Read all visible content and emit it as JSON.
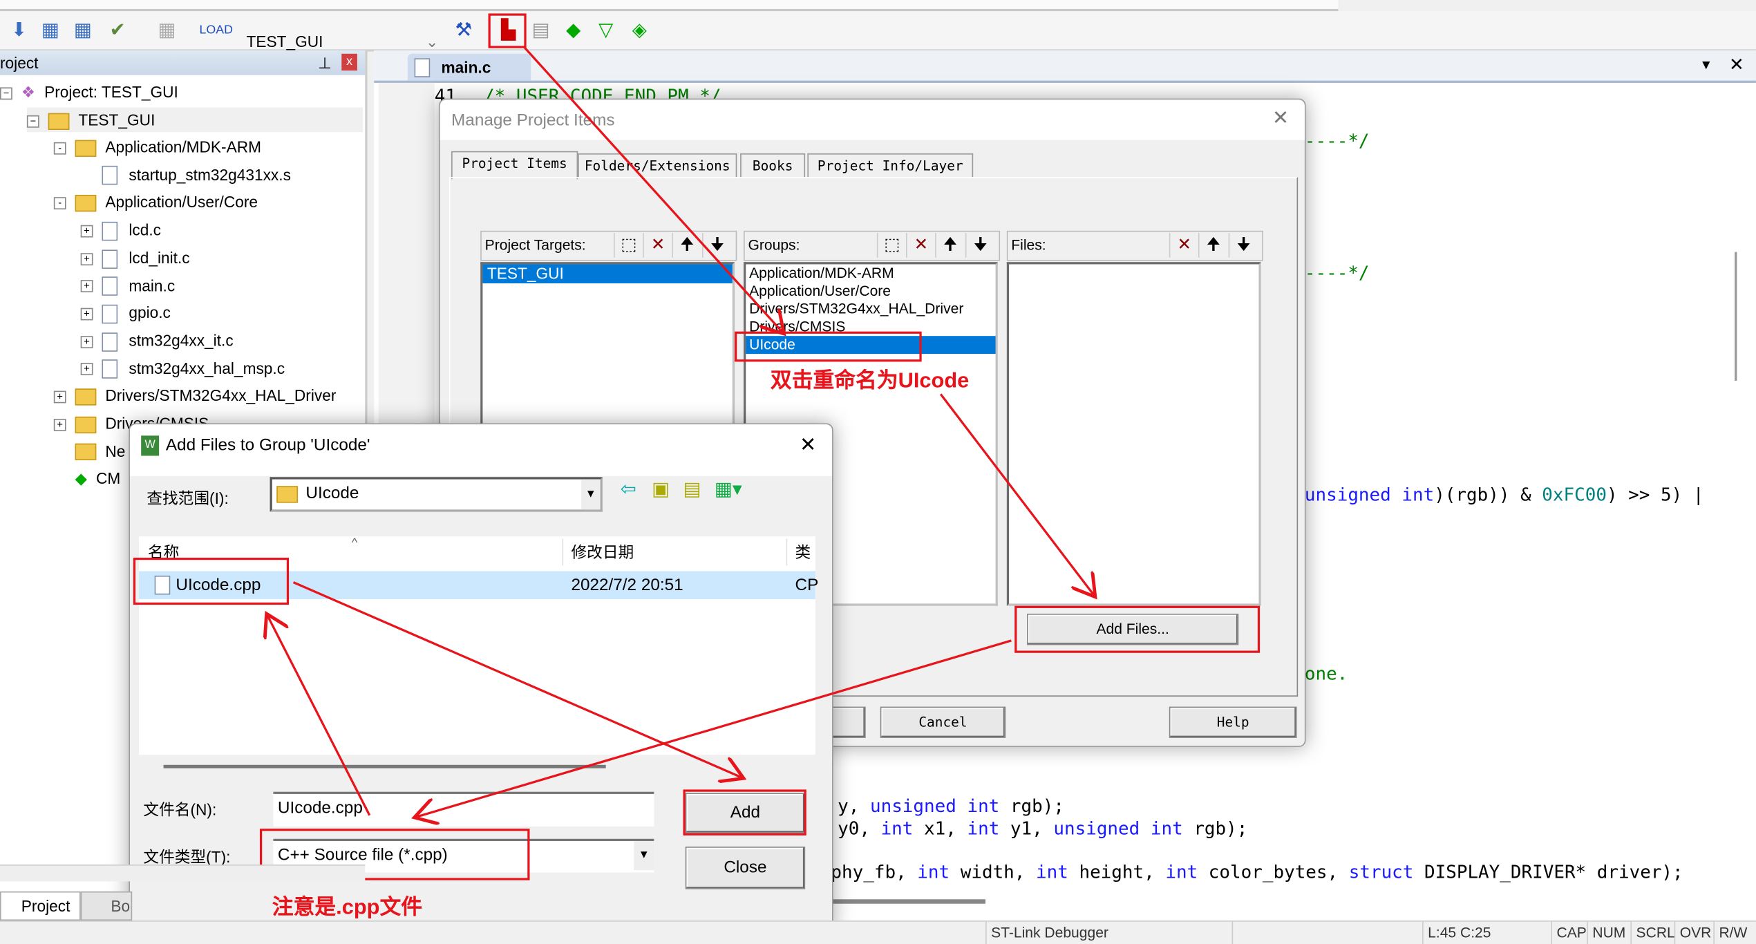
{
  "toolbar": {
    "target": "TEST_GUI",
    "icons": [
      "translate-icon",
      "build-icon",
      "rebuild-icon",
      "batch-build-icon",
      "stop-build-icon",
      "load-icon",
      "target-options-icon",
      "manage-project-items-icon",
      "select-packs-icon",
      "pack-installer-icon",
      "manage-run-time-icon",
      "software-components-icon"
    ]
  },
  "project_panel": {
    "title": "roject",
    "root": "Project: TEST_GUI",
    "target": "TEST_GUI",
    "items": [
      {
        "label": "Application/MDK-ARM",
        "type": "folder",
        "level": 2,
        "expander": "-"
      },
      {
        "label": "startup_stm32g431xx.s",
        "type": "file",
        "level": 3,
        "expander": ""
      },
      {
        "label": "Application/User/Core",
        "type": "folder",
        "level": 2,
        "expander": "-"
      },
      {
        "label": "lcd.c",
        "type": "file",
        "level": 3,
        "expander": "+"
      },
      {
        "label": "lcd_init.c",
        "type": "file",
        "level": 3,
        "expander": "+"
      },
      {
        "label": "main.c",
        "type": "file",
        "level": 3,
        "expander": "+"
      },
      {
        "label": "gpio.c",
        "type": "file",
        "level": 3,
        "expander": "+"
      },
      {
        "label": "stm32g4xx_it.c",
        "type": "file",
        "level": 3,
        "expander": "+"
      },
      {
        "label": "stm32g4xx_hal_msp.c",
        "type": "file",
        "level": 3,
        "expander": "+"
      },
      {
        "label": "Drivers/STM32G4xx_HAL_Driver",
        "type": "folder",
        "level": 2,
        "expander": "+"
      },
      {
        "label": "Drivers/CMSIS",
        "type": "folder",
        "level": 2,
        "expander": "+"
      },
      {
        "label": "Ne",
        "type": "folder",
        "level": 2,
        "expander": ""
      },
      {
        "label": "CM",
        "type": "component",
        "level": 2,
        "expander": ""
      }
    ],
    "bottom_tabs": [
      "Project",
      "Bo"
    ]
  },
  "editor": {
    "tab": "main.c",
    "line_number": "41",
    "lines": {
      "l41": "/* USER CODE END PM */",
      "sep1": "----*/",
      "sep2": "----*/",
      "expr_a": "unsigned int",
      "expr_b": ")(rgb)) & ",
      "expr_c": "0xFC00",
      "expr_d": ") >> 5) |",
      "one": "one.",
      "p1a": "y, ",
      "p1b": "unsigned int",
      " p1c": "",
      "p1c2": " rgb);",
      "p2a": "y0, ",
      "p2b": "int",
      " p2c": "",
      "p2c2": " x1, ",
      "p2d": "int",
      "p2e": " y1, ",
      "p2f": "unsigned int",
      "p2g": " rgb);",
      "p3a": "phy_fb, ",
      "p3b": "int",
      "p3c": " width, ",
      "p3d": "int",
      "p3e": " height, ",
      "p3f": "int",
      "p3g": " color_bytes, ",
      "p3h": "struct",
      "p3i": " DISPLAY_DRIVER* driver);"
    }
  },
  "manage_dialog": {
    "title": "Manage Project Items",
    "tabs": [
      "Project Items",
      "Folders/Extensions",
      "Books",
      "Project Info/Layer"
    ],
    "targets_label": "Project Targets:",
    "targets": [
      "TEST_GUI"
    ],
    "groups_label": "Groups:",
    "groups": [
      "Application/MDK-ARM",
      "Application/User/Core",
      "Drivers/STM32G4xx_HAL_Driver",
      "Drivers/CMSIS",
      "UIcode"
    ],
    "selected_group": "UIcode",
    "files_label": "Files:",
    "add_files": "Add Files...",
    "cancel": "Cancel",
    "help": "Help"
  },
  "add_dialog": {
    "title": "Add Files to Group 'UIcode'",
    "look_in_label": "查找范围(I):",
    "look_in": "UIcode",
    "columns": [
      "名称",
      "修改日期",
      "类"
    ],
    "rows": [
      {
        "name": "UIcode.cpp",
        "date": "2022/7/2 20:51",
        "type": "CP"
      }
    ],
    "filename_label": "文件名(N):",
    "filename": "UIcode.cpp",
    "filetype_label": "文件类型(T):",
    "filetype": "C++ Source file (*.cpp)",
    "add": "Add",
    "close": "Close"
  },
  "annotations": {
    "rename_note": "双击重命名为UIcode",
    "cpp_note": "注意是.cpp文件",
    "color": "#e8141c"
  },
  "status": {
    "debugger": "ST-Link Debugger",
    "position": "L:45 C:25",
    "flags": [
      "CAP",
      "NUM",
      "SCRL",
      "OVR",
      "R/W"
    ]
  }
}
